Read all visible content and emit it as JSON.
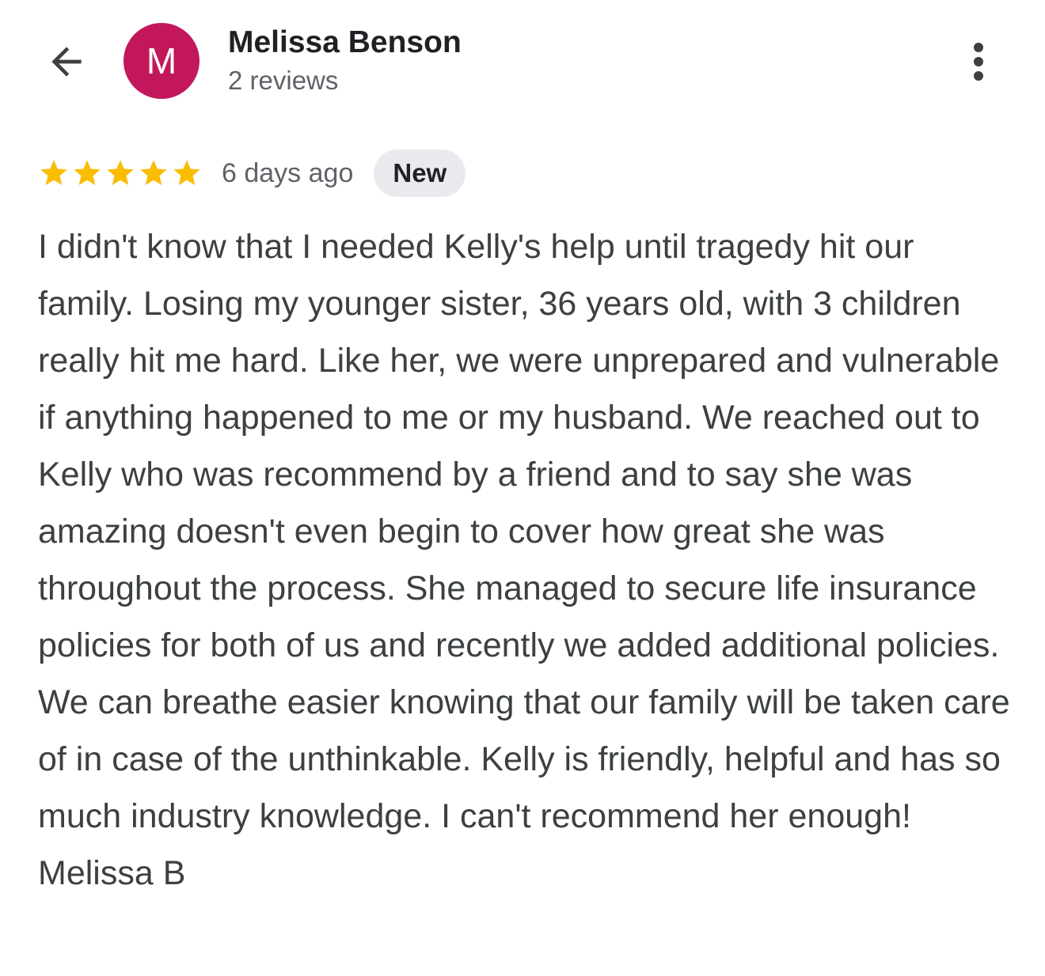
{
  "header": {
    "back_icon": "arrow-back-icon",
    "avatar_letter": "M",
    "avatar_color": "#c2185b",
    "reviewer_name": "Melissa Benson",
    "review_count": "2 reviews",
    "more_icon": "more-vert-icon"
  },
  "review": {
    "rating": 5,
    "rating_max": 5,
    "star_color": "#fbbc04",
    "time_ago": "6 days ago",
    "badge": "New",
    "text": "I didn't know that I needed Kelly's help until tragedy hit our family. Losing my younger sister, 36 years old, with 3 children really hit me hard. Like her, we were unprepared and vulnerable if anything happened to me or my husband. We reached out to Kelly who was recommend by a friend and to say she was amazing doesn't even begin to cover how great she was throughout the process. She managed to secure life insurance policies for both of us and recently we added additional policies. We can breathe easier knowing that our family will be taken care of in case of the unthinkable. Kelly is friendly, helpful and has so much industry knowledge. I can't recommend her enough! Melissa B"
  }
}
